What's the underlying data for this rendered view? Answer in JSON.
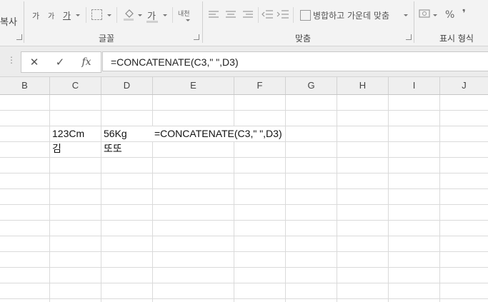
{
  "ribbon": {
    "clipboard_partial_label": "복사",
    "font": {
      "grow_font": "가",
      "shrink_font": "가",
      "underline": "가",
      "font_color": "가",
      "phonetic": "내천",
      "group_label": "글꼴"
    },
    "alignment": {
      "merge_center_label": "병합하고 가운데 맞춤",
      "group_label": "맞춤"
    },
    "number": {
      "percent": "%",
      "comma": "❜",
      "group_label": "표시 형식"
    }
  },
  "formula_bar": {
    "grip": "⋮",
    "cancel_icon": "✕",
    "enter_icon": "✓",
    "function_label": "fx",
    "formula": "=CONCATENATE(C3,\" \",D3)"
  },
  "columns": [
    "B",
    "C",
    "D",
    "E",
    "F",
    "G",
    "H",
    "I",
    "J"
  ],
  "cells": {
    "C3": "123Cm",
    "D3": "56Kg",
    "E3": "=CONCATENATE(C3,\" \",D3)",
    "C4": "김",
    "D4": "또또"
  }
}
